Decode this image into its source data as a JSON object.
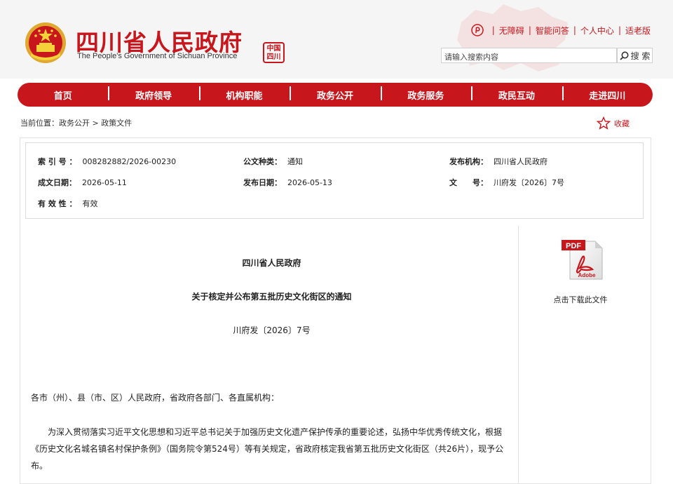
{
  "header": {
    "title": "四川省人民政府",
    "subtitle": "The People's Government of Sichuan Province",
    "seal_text": "中国四川"
  },
  "toplinks": [
    {
      "label": "无障碍"
    },
    {
      "label": "智能问答"
    },
    {
      "label": "个人中心"
    },
    {
      "label": "适老版"
    }
  ],
  "search": {
    "placeholder": "请输入搜索内容",
    "button_label": "搜 索"
  },
  "nav": [
    {
      "label": "首页"
    },
    {
      "label": "政府领导"
    },
    {
      "label": "机构职能"
    },
    {
      "label": "政务公开"
    },
    {
      "label": "政务服务"
    },
    {
      "label": "政民互动"
    },
    {
      "label": "走进四川"
    }
  ],
  "breadcrumb": {
    "text": "当前位置：政务公开 > 政策文件"
  },
  "favorite": {
    "label": "收藏"
  },
  "meta": {
    "index_label": "索 引 号 ：",
    "index_value": "008282882/2026-00230",
    "type_label": "公文种类：",
    "type_value": "通知",
    "org_label": "发布机构：",
    "org_value": "四川省人民政府",
    "created_label": "成文日期：",
    "created_value": "2026-05-11",
    "published_label": "发布日期：",
    "published_value": "2026-05-13",
    "docno_label": "文　　号：",
    "docno_value": "川府发〔2026〕7号",
    "valid_label": "有 效 性 ：",
    "valid_value": "有效"
  },
  "document": {
    "issuer": "四川省人民政府",
    "title": "关于核定并公布第五批历史文化街区的通知",
    "number": "川府发〔2026〕7号",
    "addressee": "各市（州）、县（市、区）人民政府，省政府各部门、各直属机构：",
    "paragraph": "为深入贯彻落实习近平文化思想和习近平总书记关于加强历史文化遗产保护传承的重要论述，弘扬中华优秀传统文化，根据《历史文化名城名镇名村保护条例》（国务院令第524号）等有关规定，省政府核定我省第五批历史文化街区（共26片），现予公布。"
  },
  "download": {
    "pdf_text": "PDF",
    "adobe_text": "Adobe",
    "label": "点击下载此文件"
  },
  "colors": {
    "brand_red": "#c8161d",
    "header_bg": "#f5f5f5"
  }
}
